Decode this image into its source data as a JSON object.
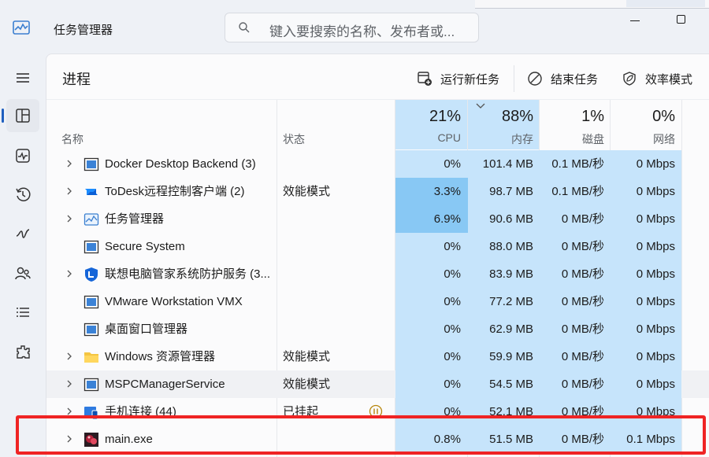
{
  "window": {
    "title": "任务管理器",
    "search_placeholder": "键入要搜索的名称、发布者或..."
  },
  "sidebar": {
    "items": [
      {
        "name": "hamburger-menu-icon",
        "active": false
      },
      {
        "name": "processes-icon",
        "active": true
      },
      {
        "name": "performance-icon",
        "active": false
      },
      {
        "name": "app-history-icon",
        "active": false
      },
      {
        "name": "startup-apps-icon",
        "active": false
      },
      {
        "name": "users-icon",
        "active": false
      },
      {
        "name": "details-icon",
        "active": false
      },
      {
        "name": "services-icon",
        "active": false
      }
    ]
  },
  "page": {
    "title": "进程",
    "actions": {
      "run_new_task": "运行新任务",
      "end_task": "结束任务",
      "efficiency_mode": "效率模式"
    }
  },
  "columns": {
    "name": "名称",
    "status": "状态",
    "cpu": {
      "pct": "21%",
      "label": "CPU"
    },
    "memory": {
      "pct": "88%",
      "label": "内存"
    },
    "disk": {
      "pct": "1%",
      "label": "磁盘"
    },
    "network": {
      "pct": "0%",
      "label": "网络"
    }
  },
  "processes": [
    {
      "name": "Docker Desktop Backend (3)",
      "status": "",
      "cpu": "0%",
      "memory": "101.4 MB",
      "disk": "0.1 MB/秒",
      "network": "0 Mbps",
      "expandable": true,
      "icon": "window-app-icon"
    },
    {
      "name": "ToDesk远程控制客户端 (2)",
      "status": "效能模式",
      "cpu": "3.3%",
      "memory": "98.7 MB",
      "disk": "0.1 MB/秒",
      "network": "0 Mbps",
      "expandable": true,
      "icon": "todesk-icon"
    },
    {
      "name": "任务管理器",
      "status": "",
      "cpu": "6.9%",
      "memory": "90.6 MB",
      "disk": "0 MB/秒",
      "network": "0 Mbps",
      "expandable": true,
      "icon": "task-manager-icon"
    },
    {
      "name": "Secure System",
      "status": "",
      "cpu": "0%",
      "memory": "88.0 MB",
      "disk": "0 MB/秒",
      "network": "0 Mbps",
      "expandable": false,
      "icon": "window-app-icon"
    },
    {
      "name": "联想电脑管家系统防护服务 (3...",
      "status": "",
      "cpu": "0%",
      "memory": "83.9 MB",
      "disk": "0 MB/秒",
      "network": "0 Mbps",
      "expandable": true,
      "icon": "lenovo-shield-icon"
    },
    {
      "name": "VMware Workstation VMX",
      "status": "",
      "cpu": "0%",
      "memory": "77.2 MB",
      "disk": "0 MB/秒",
      "network": "0 Mbps",
      "expandable": false,
      "icon": "window-app-icon"
    },
    {
      "name": "桌面窗口管理器",
      "status": "",
      "cpu": "0%",
      "memory": "62.9 MB",
      "disk": "0 MB/秒",
      "network": "0 Mbps",
      "expandable": false,
      "icon": "window-app-icon"
    },
    {
      "name": "Windows 资源管理器",
      "status": "效能模式",
      "cpu": "0%",
      "memory": "59.9 MB",
      "disk": "0 MB/秒",
      "network": "0 Mbps",
      "expandable": true,
      "icon": "folder-icon"
    },
    {
      "name": "MSPCManagerService",
      "status": "效能模式",
      "cpu": "0%",
      "memory": "54.5 MB",
      "disk": "0 MB/秒",
      "network": "0 Mbps",
      "expandable": true,
      "icon": "window-app-icon"
    },
    {
      "name": "手机连接 (44)",
      "status": "已挂起",
      "cpu": "0%",
      "memory": "52.1 MB",
      "disk": "0 MB/秒",
      "network": "0 Mbps",
      "expandable": true,
      "icon": "phone-link-icon"
    },
    {
      "name": "main.exe",
      "status": "",
      "cpu": "0.8%",
      "memory": "51.5 MB",
      "disk": "0 MB/秒",
      "network": "0.1 Mbps",
      "expandable": true,
      "icon": "main-exe-icon"
    }
  ],
  "colors": {
    "heat_light": "#c6e4fb",
    "heat_mid": "#88c8f4",
    "highlight_box": "#ef2424",
    "accent": "#1f5fbf"
  }
}
